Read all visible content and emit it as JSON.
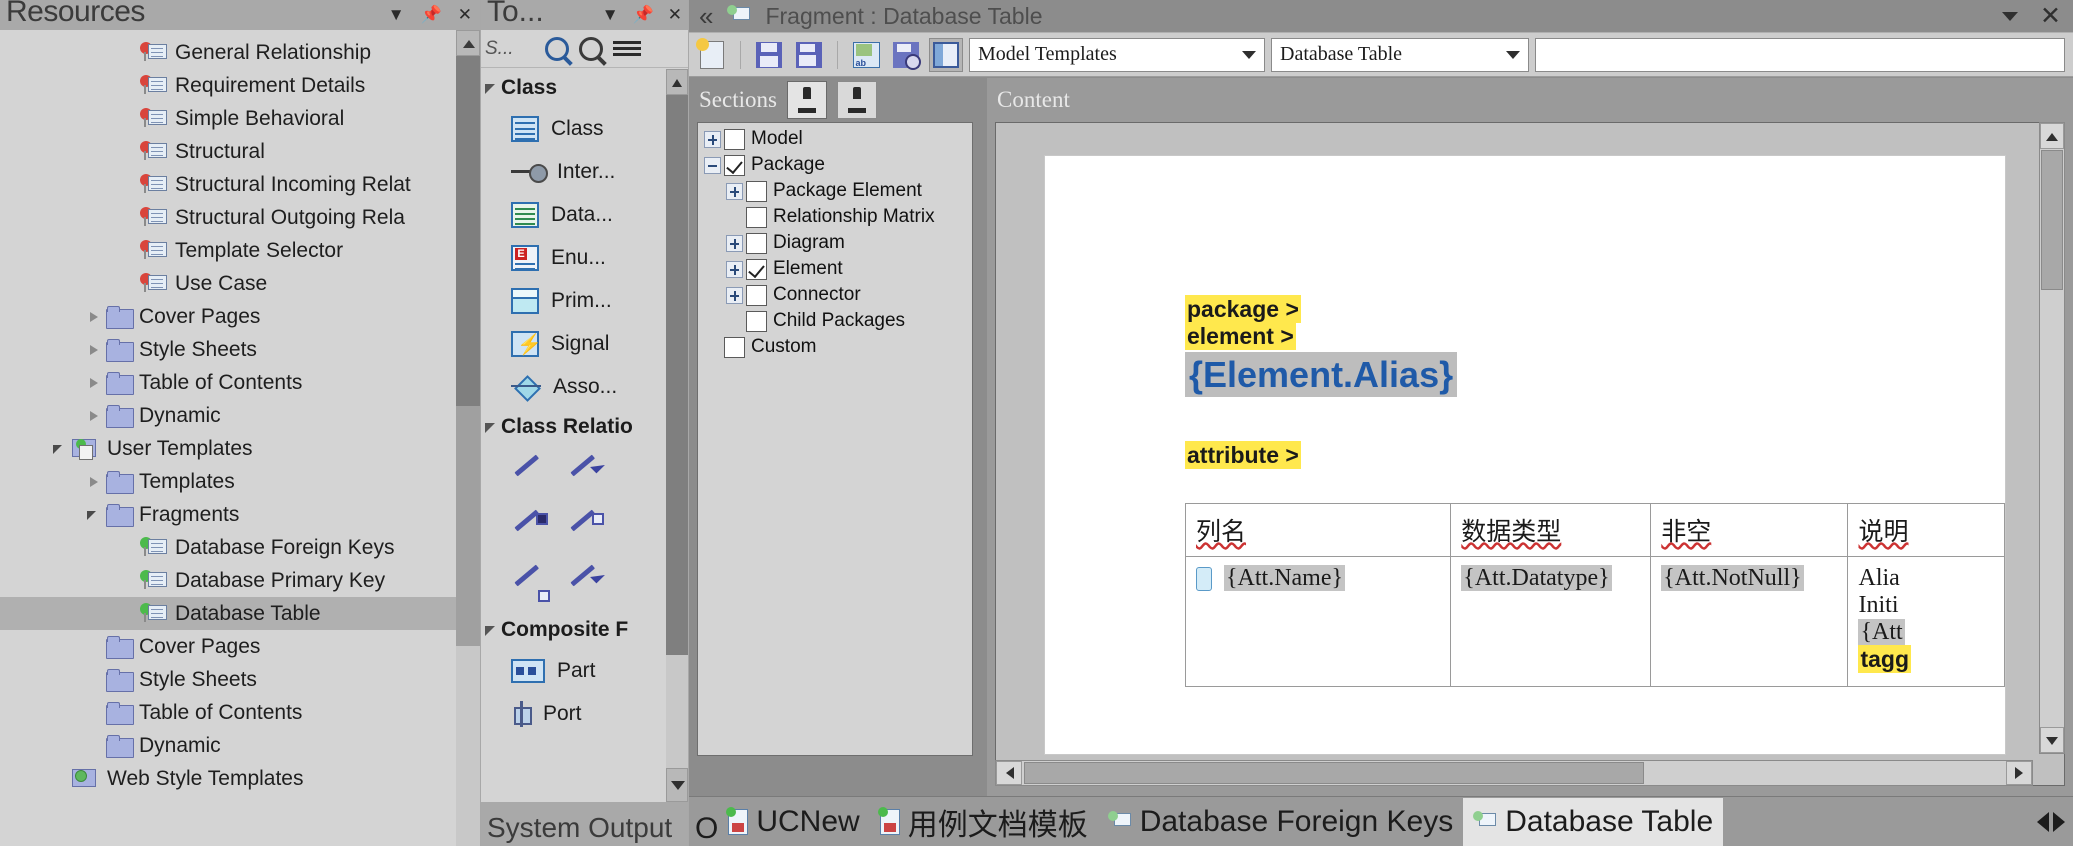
{
  "resources": {
    "title": "Resources",
    "titlebar_buttons": [
      "chevron-down",
      "pin",
      "close"
    ],
    "tree": [
      {
        "label": "General Relationship",
        "icon": "fragment-red",
        "indent": 3,
        "arrow": "none"
      },
      {
        "label": "Requirement Details",
        "icon": "fragment-red",
        "indent": 3,
        "arrow": "none"
      },
      {
        "label": "Simple Behavioral",
        "icon": "fragment-red",
        "indent": 3,
        "arrow": "none"
      },
      {
        "label": "Structural",
        "icon": "fragment-red",
        "indent": 3,
        "arrow": "none"
      },
      {
        "label": "Structural Incoming Relat",
        "icon": "fragment-red",
        "indent": 3,
        "arrow": "none"
      },
      {
        "label": "Structural Outgoing Rela",
        "icon": "fragment-red",
        "indent": 3,
        "arrow": "none"
      },
      {
        "label": "Template Selector",
        "icon": "fragment-red",
        "indent": 3,
        "arrow": "none"
      },
      {
        "label": "Use Case",
        "icon": "fragment-red",
        "indent": 3,
        "arrow": "none"
      },
      {
        "label": "Cover Pages",
        "icon": "folder",
        "indent": 2,
        "arrow": "collapsed"
      },
      {
        "label": "Style Sheets",
        "icon": "folder",
        "indent": 2,
        "arrow": "collapsed"
      },
      {
        "label": "Table of Contents",
        "icon": "folder",
        "indent": 2,
        "arrow": "collapsed"
      },
      {
        "label": "Dynamic",
        "icon": "folder",
        "indent": 2,
        "arrow": "collapsed"
      },
      {
        "label": "User Templates",
        "icon": "user-templates",
        "indent": 1,
        "arrow": "expanded"
      },
      {
        "label": "Templates",
        "icon": "folder",
        "indent": 2,
        "arrow": "collapsed"
      },
      {
        "label": "Fragments",
        "icon": "folder",
        "indent": 2,
        "arrow": "expanded"
      },
      {
        "label": "Database Foreign Keys",
        "icon": "fragment-green",
        "indent": 3,
        "arrow": "none"
      },
      {
        "label": "Database Primary Key",
        "icon": "fragment-green",
        "indent": 3,
        "arrow": "none"
      },
      {
        "label": "Database Table",
        "icon": "fragment-green",
        "indent": 3,
        "arrow": "none",
        "selected": true
      },
      {
        "label": "Cover Pages",
        "icon": "folder",
        "indent": 2,
        "arrow": "none"
      },
      {
        "label": "Style Sheets",
        "icon": "folder",
        "indent": 2,
        "arrow": "none"
      },
      {
        "label": "Table of Contents",
        "icon": "folder",
        "indent": 2,
        "arrow": "none"
      },
      {
        "label": "Dynamic",
        "icon": "folder",
        "indent": 2,
        "arrow": "none"
      },
      {
        "label": "Web Style Templates",
        "icon": "web-templates",
        "indent": 1,
        "arrow": "none"
      }
    ]
  },
  "toolbox": {
    "title": "To...",
    "search_placeholder": "S...",
    "groups": [
      {
        "name": "Class",
        "items": [
          {
            "label": "Class",
            "icon": "class-icon"
          },
          {
            "label": "Inter...",
            "icon": "interface-icon"
          },
          {
            "label": "Data...",
            "icon": "datatype-icon"
          },
          {
            "label": "Enu...",
            "icon": "enumeration-icon"
          },
          {
            "label": "Prim...",
            "icon": "primitive-icon"
          },
          {
            "label": "Signal",
            "icon": "signal-icon"
          },
          {
            "label": "Asso...",
            "icon": "association-class-icon"
          }
        ]
      },
      {
        "name": "Class Relatio",
        "relations": [
          "associate-icon",
          "generalize-icon",
          "compose-icon",
          "aggregate-icon",
          "associate-note-icon",
          "realize-icon"
        ]
      },
      {
        "name": "Composite F",
        "items": [
          {
            "label": "Part",
            "icon": "part-icon"
          },
          {
            "label": "Port",
            "icon": "port-icon"
          }
        ]
      }
    ],
    "system_output_label": "System Output"
  },
  "main": {
    "titlebar": {
      "collapse_icon": "double-chevron-left",
      "doc_icon": "fragment-green",
      "title": "Fragment : Database Table",
      "right_buttons": [
        "chevron-down",
        "close"
      ]
    },
    "toolbar": {
      "buttons": [
        {
          "name": "new-document",
          "icon": "new-doc-icon",
          "active": false
        },
        {
          "name": "save",
          "icon": "save-icon",
          "active": false
        },
        {
          "name": "save-all",
          "icon": "save-all-icon",
          "active": false
        },
        {
          "name": "spell-check",
          "icon": "spell-check-icon",
          "active": false
        },
        {
          "name": "find",
          "icon": "find-icon",
          "active": false
        },
        {
          "name": "toggle-pane",
          "icon": "pane-icon",
          "active": true
        }
      ],
      "template_group": "Model Templates",
      "template_name": "Database Table",
      "extra_field": ""
    },
    "sections": {
      "label": "Sections",
      "toolbar_buttons": [
        "stamp-apply-icon",
        "stamp-clear-icon"
      ],
      "tree": [
        {
          "label": "Model",
          "indent": 0,
          "expander": "plus",
          "checked": false
        },
        {
          "label": "Package",
          "indent": 0,
          "expander": "minus",
          "checked": true
        },
        {
          "label": "Package Element",
          "indent": 1,
          "expander": "plus",
          "checked": false
        },
        {
          "label": "Relationship Matrix",
          "indent": 1,
          "expander": "none",
          "checked": false
        },
        {
          "label": "Diagram",
          "indent": 1,
          "expander": "plus",
          "checked": false
        },
        {
          "label": "Element",
          "indent": 1,
          "expander": "plus",
          "checked": true
        },
        {
          "label": "Connector",
          "indent": 1,
          "expander": "plus",
          "checked": false
        },
        {
          "label": "Child Packages",
          "indent": 1,
          "expander": "none",
          "checked": false
        },
        {
          "label": "Custom",
          "indent": 0,
          "expander": "none",
          "checked": false
        }
      ]
    },
    "content": {
      "label": "Content",
      "document": {
        "tag_package": "package >",
        "tag_element": "element >",
        "field_alias": "{Element.Alias}",
        "tag_attribute": "attribute >",
        "table": {
          "headers": [
            "列名",
            "数据类型",
            "非空",
            "说明"
          ],
          "rows": [
            {
              "name": "{Att.Name}",
              "datatype": "{Att.Datatype}",
              "notnull": "{Att.NotNull}",
              "desc_lines": [
                "Alia",
                "Initi",
                "{Att",
                "tagg"
              ]
            }
          ]
        }
      }
    }
  },
  "tabs": {
    "truncated_left": "O",
    "items": [
      {
        "label": "UCNew",
        "icon": "doc-template-icon",
        "active": false
      },
      {
        "label": "用例文档模板",
        "icon": "doc-template-icon",
        "active": false
      },
      {
        "label": "Database Foreign Keys",
        "icon": "fragment-green-icon",
        "active": false
      },
      {
        "label": "Database Table",
        "icon": "fragment-green-icon",
        "active": true
      }
    ],
    "nav": [
      "prev-tab-arrow",
      "next-tab-arrow"
    ]
  },
  "colors": {
    "panel_bg": "#d4d4d4",
    "titlebar_bg": "#a9a9a9",
    "selection_bg": "#b0b0b0",
    "highlight_yellow": "#ffe84d",
    "field_blue": "#1f5aa8",
    "field_grey": "#bdbdbd",
    "main_bg": "#8c8c8c"
  }
}
